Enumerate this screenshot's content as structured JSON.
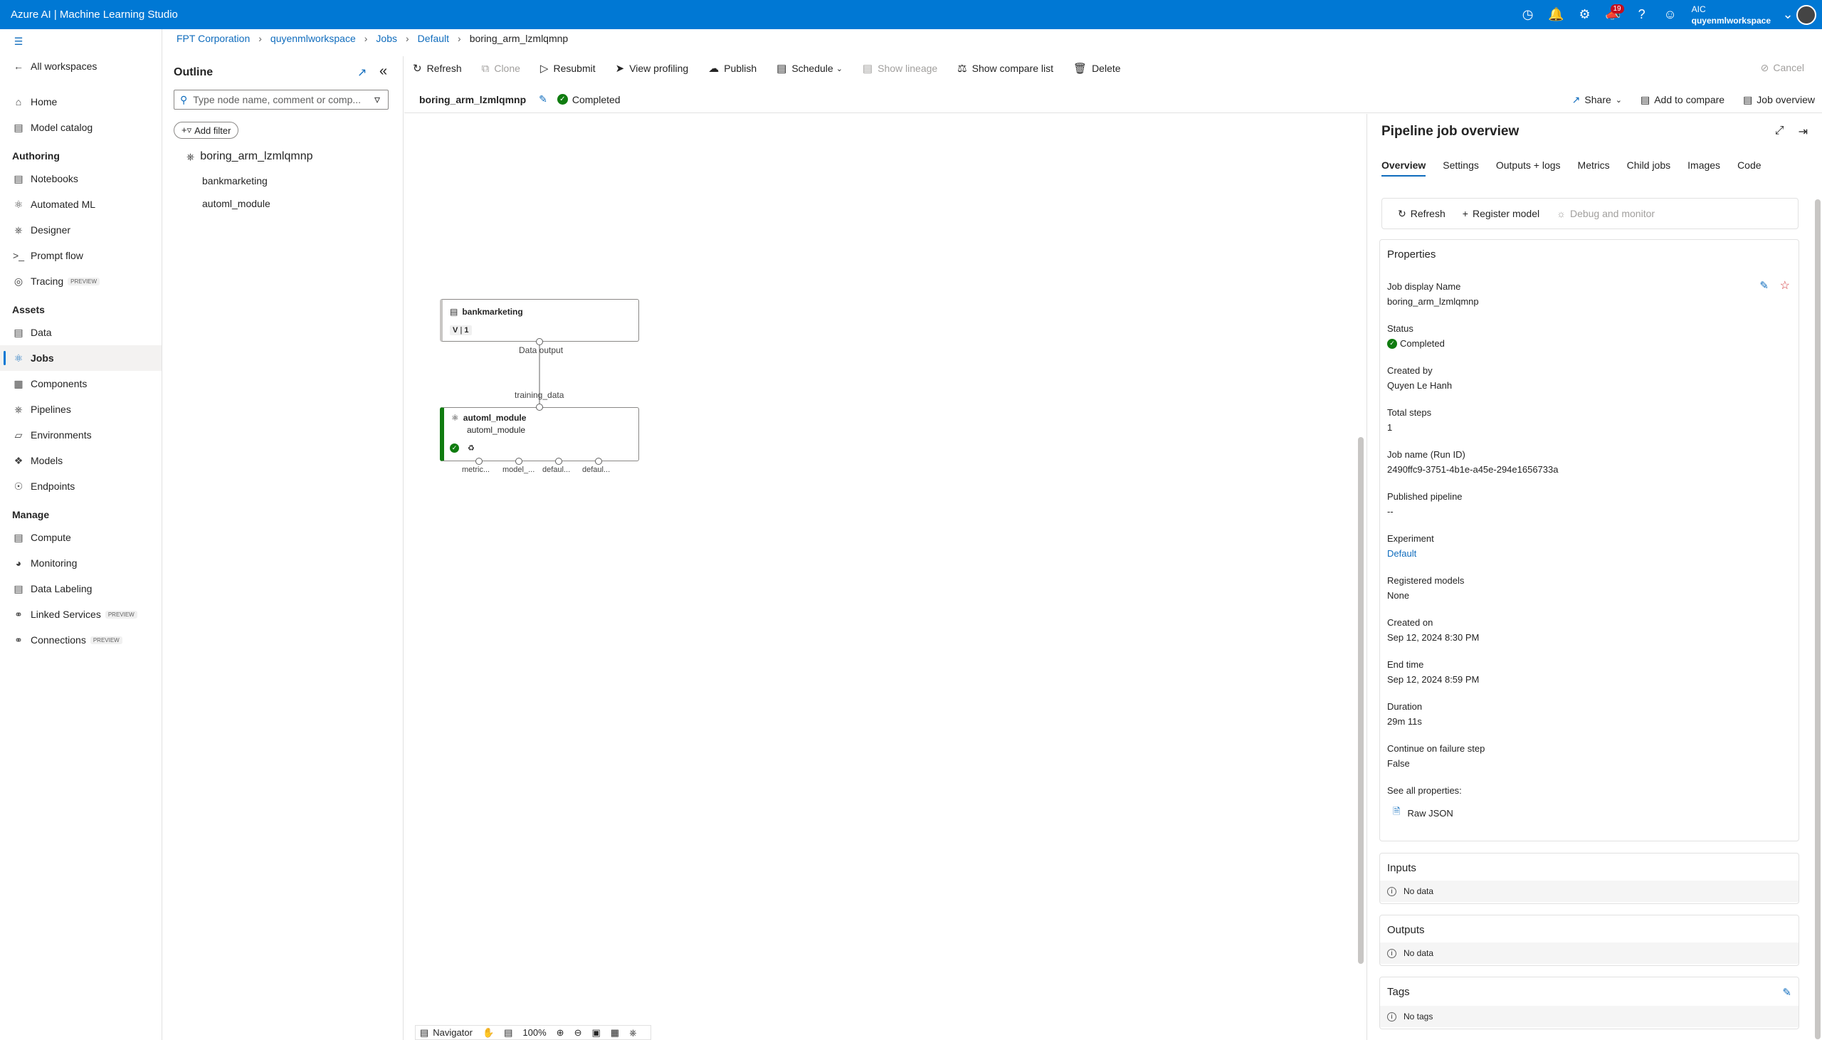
{
  "header": {
    "brand": "Azure AI | Machine Learning Studio",
    "notif_count": "19",
    "account_org": "AIC",
    "account_workspace": "quyenmlworkspace"
  },
  "sidebar": {
    "all_workspaces": "All workspaces",
    "home": "Home",
    "model_catalog": "Model catalog",
    "authoring": "Authoring",
    "notebooks": "Notebooks",
    "automated_ml": "Automated ML",
    "designer": "Designer",
    "prompt_flow": "Prompt flow",
    "tracing": "Tracing",
    "preview": "PREVIEW",
    "assets": "Assets",
    "data": "Data",
    "jobs": "Jobs",
    "components": "Components",
    "pipelines": "Pipelines",
    "environments": "Environments",
    "models": "Models",
    "endpoints": "Endpoints",
    "manage": "Manage",
    "compute": "Compute",
    "monitoring": "Monitoring",
    "data_labeling": "Data Labeling",
    "linked_services": "Linked Services",
    "connections": "Connections"
  },
  "breadcrumb": {
    "org": "FPT Corporation",
    "workspace": "quyenmlworkspace",
    "jobs": "Jobs",
    "experiment": "Default",
    "job": "boring_arm_lzmlqmnp"
  },
  "outline": {
    "title": "Outline",
    "search_placeholder": "Type node name, comment or comp...",
    "add_filter": "Add filter",
    "root": "boring_arm_lzmlqmnp",
    "children": [
      "bankmarketing",
      "automl_module"
    ]
  },
  "toolbar": {
    "refresh": "Refresh",
    "clone": "Clone",
    "resubmit": "Resubmit",
    "view_profiling": "View profiling",
    "publish": "Publish",
    "schedule": "Schedule",
    "show_lineage": "Show lineage",
    "show_compare": "Show compare list",
    "delete": "Delete",
    "cancel": "Cancel"
  },
  "jobbar": {
    "name": "boring_arm_lzmlqmnp",
    "status": "Completed",
    "share": "Share",
    "add_compare": "Add to compare",
    "job_overview": "Job overview"
  },
  "graph": {
    "node1_title": "bankmarketing",
    "node1_version_label": "V",
    "node1_version": "1",
    "node1_output": "Data output",
    "node2_input": "training_data",
    "node2_title": "automl_module",
    "node2_subtitle": "automl_module",
    "node2_outputs": [
      "metric...",
      "model_...",
      "defaul...",
      "defaul..."
    ]
  },
  "navigator": {
    "label": "Navigator",
    "zoom": "100%"
  },
  "panel": {
    "title": "Pipeline job overview",
    "tabs": [
      "Overview",
      "Settings",
      "Outputs + logs",
      "Metrics",
      "Child jobs",
      "Images",
      "Code"
    ],
    "actions": {
      "refresh": "Refresh",
      "register": "Register model",
      "debug": "Debug and monitor"
    },
    "properties_title": "Properties",
    "props": {
      "display_name_k": "Job display Name",
      "display_name_v": "boring_arm_lzmlqmnp",
      "status_k": "Status",
      "status_v": "Completed",
      "created_by_k": "Created by",
      "created_by_v": "Quyen Le Hanh",
      "total_steps_k": "Total steps",
      "total_steps_v": "1",
      "job_name_k": "Job name (Run ID)",
      "job_name_v": "2490ffc9-3751-4b1e-a45e-294e1656733a",
      "published_k": "Published pipeline",
      "published_v": "--",
      "experiment_k": "Experiment",
      "experiment_v": "Default",
      "registered_k": "Registered models",
      "registered_v": "None",
      "created_on_k": "Created on",
      "created_on_v": "Sep 12, 2024 8:30 PM",
      "end_time_k": "End time",
      "end_time_v": "Sep 12, 2024 8:59 PM",
      "duration_k": "Duration",
      "duration_v": "29m 11s",
      "continue_k": "Continue on failure step",
      "continue_v": "False",
      "see_all": "See all properties:",
      "raw_json": "Raw JSON"
    },
    "inputs_title": "Inputs",
    "inputs_nodata": "No data",
    "outputs_title": "Outputs",
    "outputs_nodata": "No data",
    "tags_title": "Tags",
    "tags_nodata": "No tags"
  },
  "colors": {
    "brand_blue": "#0078d4",
    "link": "#0f6cbd",
    "success": "#107c10",
    "badge_red": "#c50f1f"
  }
}
